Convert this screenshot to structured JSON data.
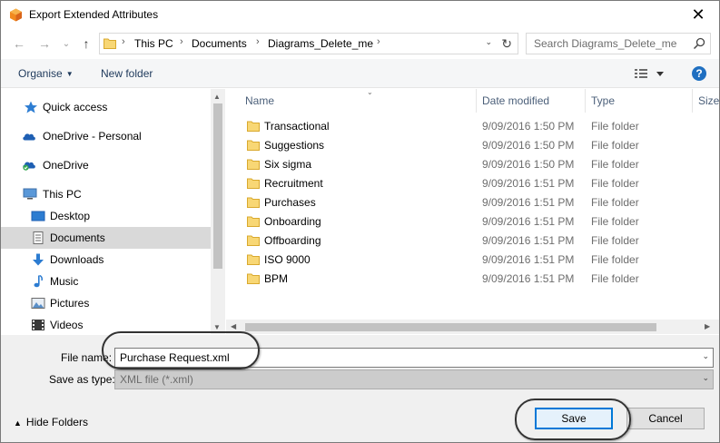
{
  "window": {
    "title": "Export Extended Attributes",
    "close_glyph": "✕",
    "app_icon": "cube-icon"
  },
  "nav": {
    "back_glyph": "←",
    "forward_glyph": "→",
    "recent_glyph": "⌄",
    "up_glyph": "↑",
    "breadcrumb": [
      "This PC",
      "Documents",
      "Diagrams_Delete_me"
    ],
    "separator": "›",
    "dropdown_glyph": "⌄",
    "refresh_glyph": "↻"
  },
  "search": {
    "placeholder": "Search Diagrams_Delete_me"
  },
  "toolbar": {
    "organise_label": "Organise",
    "new_folder_label": "New folder",
    "help_label": "?"
  },
  "nav_pane": {
    "items": [
      {
        "label": "Quick access",
        "icon": "star-icon"
      },
      {
        "label": "OneDrive - Personal",
        "icon": "cloud-icon"
      },
      {
        "label": "OneDrive",
        "icon": "cloud-sync-icon"
      },
      {
        "label": "This PC",
        "icon": "computer-icon"
      },
      {
        "label": "Desktop",
        "icon": "desktop-icon"
      },
      {
        "label": "Documents",
        "icon": "documents-icon",
        "selected": true
      },
      {
        "label": "Downloads",
        "icon": "download-icon"
      },
      {
        "label": "Music",
        "icon": "music-icon"
      },
      {
        "label": "Pictures",
        "icon": "pictures-icon"
      },
      {
        "label": "Videos",
        "icon": "videos-icon"
      }
    ]
  },
  "file_list": {
    "columns": [
      "Name",
      "Date modified",
      "Type",
      "Size"
    ],
    "rows": [
      {
        "name": "Transactional",
        "date": "9/09/2016 1:50 PM",
        "type": "File folder"
      },
      {
        "name": "Suggestions",
        "date": "9/09/2016 1:50 PM",
        "type": "File folder"
      },
      {
        "name": "Six sigma",
        "date": "9/09/2016 1:50 PM",
        "type": "File folder"
      },
      {
        "name": "Recruitment",
        "date": "9/09/2016 1:51 PM",
        "type": "File folder"
      },
      {
        "name": "Purchases",
        "date": "9/09/2016 1:51 PM",
        "type": "File folder"
      },
      {
        "name": "Onboarding",
        "date": "9/09/2016 1:51 PM",
        "type": "File folder"
      },
      {
        "name": "Offboarding",
        "date": "9/09/2016 1:51 PM",
        "type": "File folder"
      },
      {
        "name": "ISO 9000",
        "date": "9/09/2016 1:51 PM",
        "type": "File folder"
      },
      {
        "name": "BPM",
        "date": "9/09/2016 1:51 PM",
        "type": "File folder"
      }
    ]
  },
  "save_form": {
    "file_name_label": "File name:",
    "file_name_value": "Purchase Request.xml",
    "save_as_type_label": "Save as type:",
    "save_as_type_value": "XML file (*.xml)"
  },
  "footer": {
    "hide_folders_label": "Hide Folders",
    "save_label": "Save",
    "cancel_label": "Cancel"
  },
  "colors": {
    "accent": "#0078d7",
    "folder": "#f8d775",
    "selected_nav": "#d9d9d9",
    "help": "#1f6fc1"
  }
}
